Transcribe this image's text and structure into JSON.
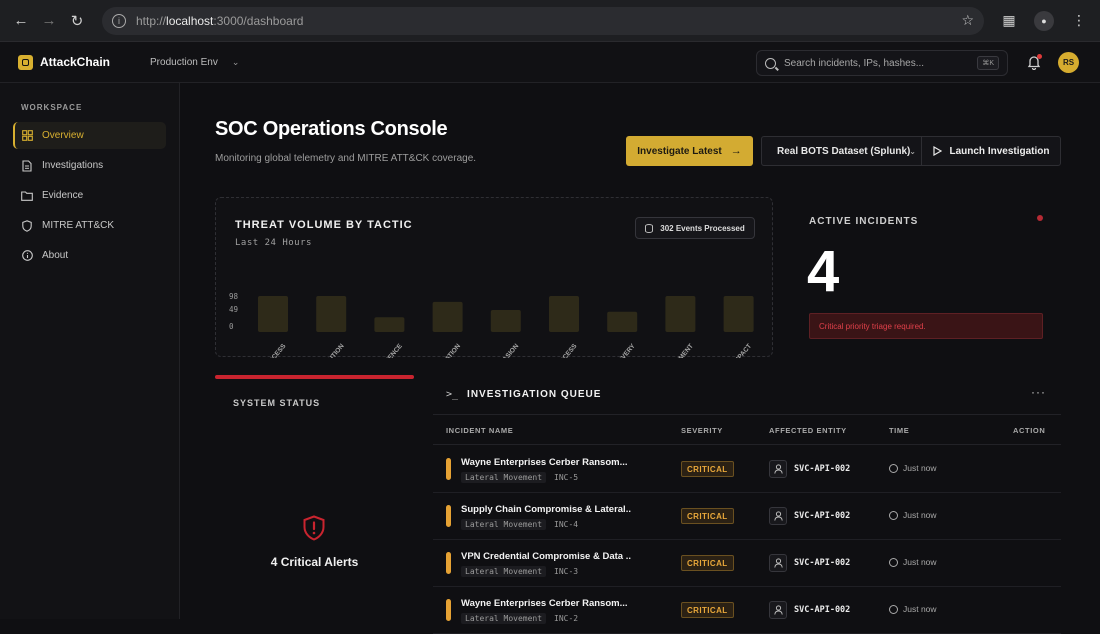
{
  "browser": {
    "url_scheme": "http://",
    "url_host": "localhost",
    "url_path": ":3000/dashboard"
  },
  "header": {
    "brand": "AttackChain",
    "environment": "Production Env",
    "search_placeholder": "Search incidents, IPs, hashes...",
    "search_shortcut": "⌘K",
    "user_initials": "RS"
  },
  "sidebar": {
    "section_label": "WORKSPACE",
    "items": [
      {
        "label": "Overview",
        "icon": "grid-icon",
        "active": true
      },
      {
        "label": "Investigations",
        "icon": "document-icon",
        "active": false
      },
      {
        "label": "Evidence",
        "icon": "folder-icon",
        "active": false
      },
      {
        "label": "MITRE ATT&CK",
        "icon": "shield-icon",
        "active": false
      },
      {
        "label": "About",
        "icon": "info-icon",
        "active": false
      }
    ]
  },
  "page": {
    "title": "SOC Operations Console",
    "subtitle": "Monitoring global telemetry and MITRE ATT&CK coverage.",
    "investigate_label": "Investigate Latest",
    "dataset_selected": "Real BOTS Dataset (Splunk)",
    "launch_label": "Launch Investigation"
  },
  "threat_chart": {
    "title": "THREAT VOLUME BY TACTIC",
    "subtitle": "Last 24 Hours",
    "events_badge": "302 Events Processed"
  },
  "chart_data": {
    "type": "bar",
    "title": "THREAT VOLUME BY TACTIC",
    "categories": [
      "INITIAL ACCESS",
      "EXECUTION",
      "PERSISTENCE",
      "PRIVILEGE ESCALATION",
      "DEFENSE EVASION",
      "CREDENTIAL ACCESS",
      "DISCOVERY",
      "LATERAL MOVEMENT",
      "IMPACT"
    ],
    "values": [
      98,
      98,
      40,
      82,
      60,
      98,
      55,
      98,
      98
    ],
    "y_ticks": [
      "98",
      "49",
      "0"
    ],
    "ylim": [
      0,
      98
    ],
    "bar_color": "#2e2a19"
  },
  "active_incidents": {
    "label": "ACTIVE INCIDENTS",
    "count": "4",
    "alert": "Critical priority triage required."
  },
  "system_status": {
    "label": "SYSTEM STATUS",
    "alerts": "4 Critical Alerts"
  },
  "queue": {
    "title": "INVESTIGATION QUEUE",
    "more": "···",
    "columns": {
      "name": "INCIDENT NAME",
      "severity": "SEVERITY",
      "entity": "AFFECTED ENTITY",
      "time": "TIME",
      "action": "ACTION"
    },
    "rows": [
      {
        "name": "Wayne Enterprises Cerber Ransom...",
        "tactic": "Lateral Movement",
        "id": "INC-5",
        "severity": "CRITICAL",
        "entity": "SVC-API-002",
        "time": "Just now"
      },
      {
        "name": "Supply Chain Compromise & Lateral...",
        "tactic": "Lateral Movement",
        "id": "INC-4",
        "severity": "CRITICAL",
        "entity": "SVC-API-002",
        "time": "Just now"
      },
      {
        "name": "VPN Credential Compromise & Data ...",
        "tactic": "Lateral Movement",
        "id": "INC-3",
        "severity": "CRITICAL",
        "entity": "SVC-API-002",
        "time": "Just now"
      },
      {
        "name": "Wayne Enterprises Cerber Ransom...",
        "tactic": "Lateral Movement",
        "id": "INC-2",
        "severity": "CRITICAL",
        "entity": "SVC-API-002",
        "time": "Just now"
      }
    ]
  },
  "colors": {
    "accent": "#d3ab32",
    "critical": "#e8a73a",
    "danger": "#c9242f"
  }
}
